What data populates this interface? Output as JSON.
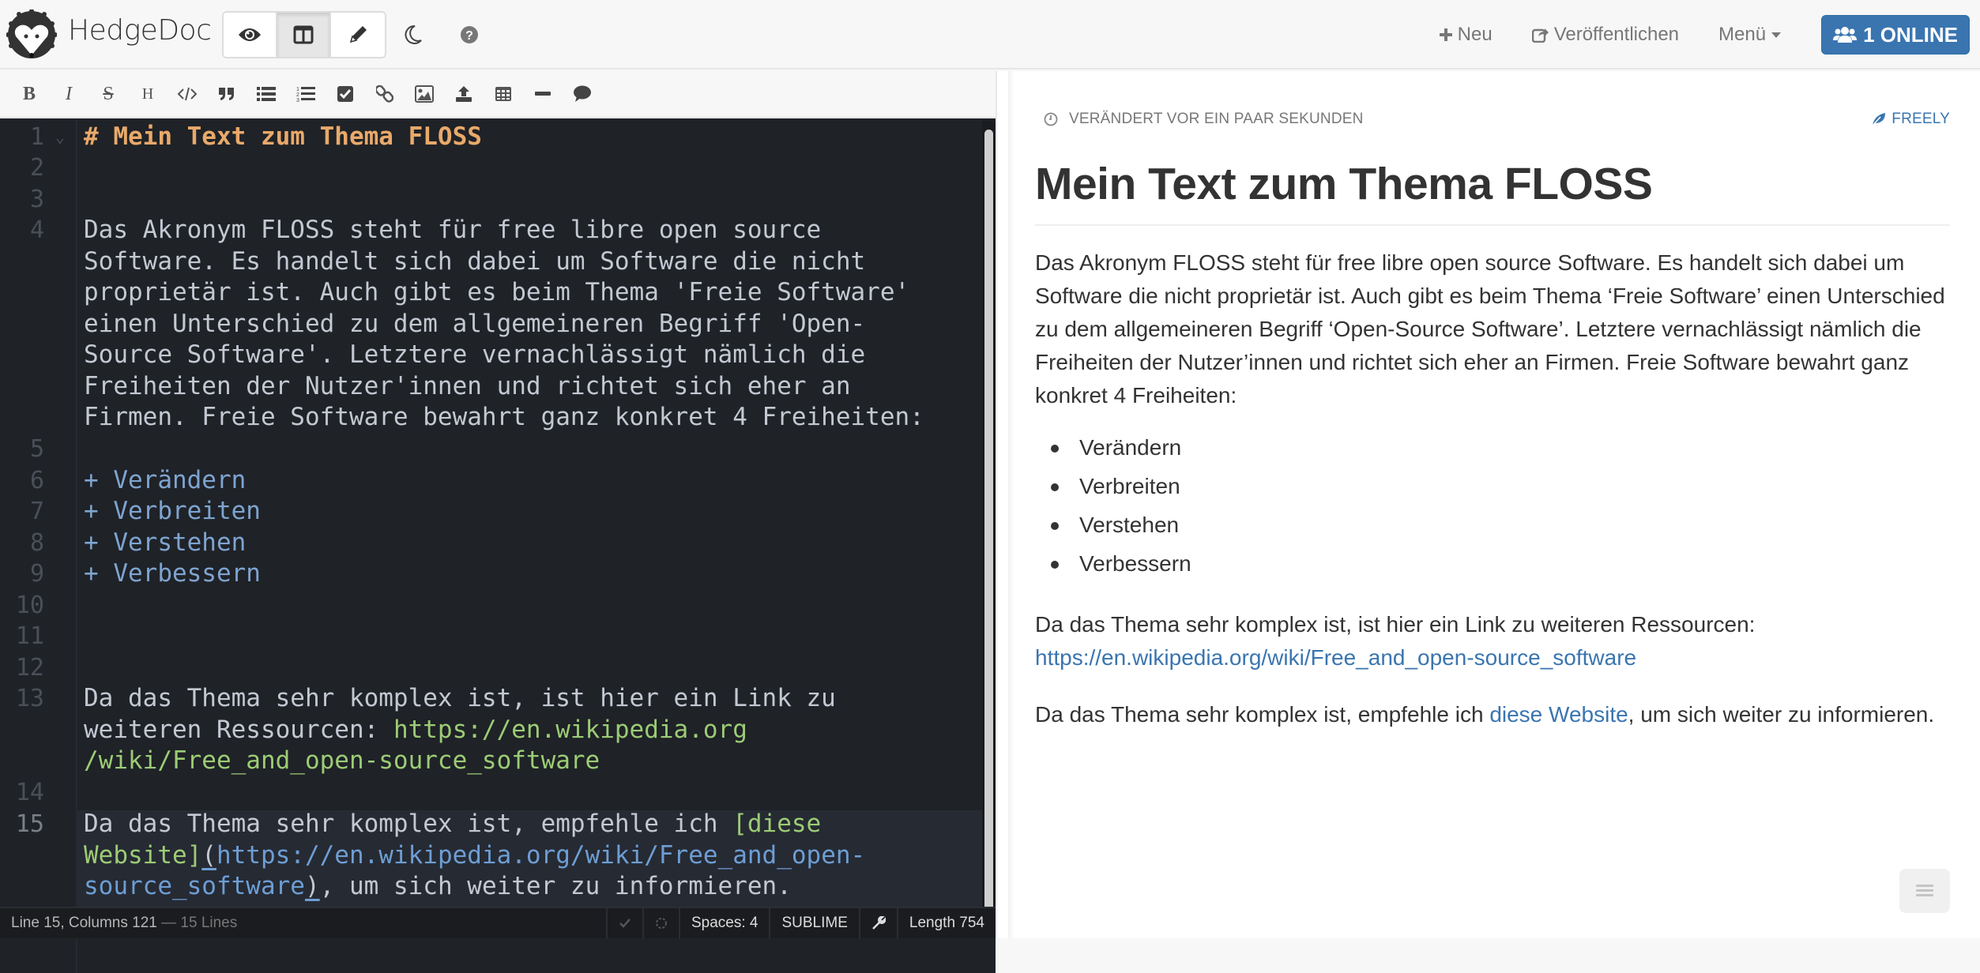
{
  "navbar": {
    "brand": "HedgeDoc",
    "view_modes": [
      {
        "name": "view",
        "icon": "eye-icon",
        "active": false
      },
      {
        "name": "both",
        "icon": "columns-icon",
        "active": true
      },
      {
        "name": "edit",
        "icon": "pencil-icon",
        "active": false
      }
    ],
    "night_mode_icon": "moon-icon",
    "help_icon": "question-circle-icon",
    "new_label": "Neu",
    "publish_label": "Veröffentlichen",
    "menu_label": "Menü",
    "online_label": "1 ONLINE",
    "accent_color": "#3a75b0"
  },
  "toolbar": {
    "buttons": [
      {
        "name": "bold",
        "icon": "bold-icon"
      },
      {
        "name": "italic",
        "icon": "italic-icon"
      },
      {
        "name": "strikethrough",
        "icon": "strikethrough-icon"
      },
      {
        "name": "header",
        "icon": "header-icon"
      },
      {
        "name": "code",
        "icon": "code-icon"
      },
      {
        "name": "quote",
        "icon": "quote-icon"
      },
      {
        "name": "unordered-list",
        "icon": "list-icon"
      },
      {
        "name": "ordered-list",
        "icon": "ordered-list-icon"
      },
      {
        "name": "check-list",
        "icon": "checkbox-icon"
      },
      {
        "name": "link",
        "icon": "link-icon"
      },
      {
        "name": "image",
        "icon": "image-icon"
      },
      {
        "name": "upload",
        "icon": "upload-icon"
      },
      {
        "name": "table",
        "icon": "table-icon"
      },
      {
        "name": "horizontal-line",
        "icon": "minus-icon"
      },
      {
        "name": "comment",
        "icon": "comment-icon"
      }
    ],
    "bold_glyph": "B",
    "italic_glyph": "I",
    "strike_glyph": "S",
    "header_glyph": "H"
  },
  "editor": {
    "lines": [
      {
        "n": "1",
        "text": "# Mein Text zum Thema FLOSS"
      },
      {
        "n": "2",
        "text": ""
      },
      {
        "n": "3",
        "text": ""
      },
      {
        "n": "4",
        "wrapped": [
          "Das Akronym FLOSS steht für free libre open source",
          "Software. Es handelt sich dabei um Software die nicht",
          "proprietär ist. Auch gibt es beim Thema 'Freie Software'",
          "einen Unterschied zu dem allgemeineren Begriff 'Open-",
          "Source Software'. Letztere vernachlässigt nämlich die",
          "Freiheiten der Nutzer'innen und richtet sich eher an",
          "Firmen. Freie Software bewahrt ganz konkret 4 Freiheiten:"
        ]
      },
      {
        "n": "5",
        "text": ""
      },
      {
        "n": "6",
        "text": "+ Verändern"
      },
      {
        "n": "7",
        "text": "+ Verbreiten"
      },
      {
        "n": "8",
        "text": "+ Verstehen"
      },
      {
        "n": "9",
        "text": "+ Verbessern"
      },
      {
        "n": "10",
        "text": ""
      },
      {
        "n": "11",
        "text": ""
      },
      {
        "n": "12",
        "text": ""
      },
      {
        "n": "13",
        "wrapped": [
          "Da das Thema sehr komplex ist, ist hier ein Link zu",
          "weiteren Ressourcen: ",
          "/wiki/Free_and_open-source_software"
        ],
        "url_part1": "https://en.wikipedia.org"
      },
      {
        "n": "14",
        "text": ""
      },
      {
        "n": "15",
        "line1_plain": "Da das Thema sehr komplex ist, empfehle ich ",
        "line1_link": "[diese",
        "line2_link": "Website]",
        "line2_paren": "(",
        "line2_url": "https://en.wikipedia.org/wiki/Free_and_open-",
        "line3_url": "source_software",
        "line3_paren": ")",
        "line3_rest": ", um sich weiter zu informieren."
      }
    ]
  },
  "statusbar": {
    "position": "Line 15, Columns 121",
    "line_count": "— 15 Lines",
    "spaces": "Spaces: 4",
    "keymap": "SUBLIME",
    "length": "Length 754"
  },
  "preview": {
    "changed": "VERÄNDERT VOR EIN PAAR SEKUNDEN",
    "permission": "FREELY",
    "title": "Mein Text zum Thema FLOSS",
    "paragraph1": "Das Akronym FLOSS steht für free libre open source Software. Es handelt sich dabei um Software die nicht proprietär ist. Auch gibt es beim Thema ‘Freie Software’ einen Unterschied zu dem allgemeineren Begriff ‘Open-Source Software’. Letztere vernachlässigt nämlich die Freiheiten der Nutzer’innen und richtet sich eher an Firmen. Freie Software bewahrt ganz konkret 4 Freiheiten:",
    "list": [
      "Verändern",
      "Verbreiten",
      "Verstehen",
      "Verbessern"
    ],
    "paragraph2_text": "Da das Thema sehr komplex ist, ist hier ein Link zu weiteren Ressourcen:",
    "paragraph2_link": "https://en.wikipedia.org/wiki/Free_and_open-source_software",
    "paragraph3_before": "Da das Thema sehr komplex ist, empfehle ich ",
    "paragraph3_link": "diese Website",
    "paragraph3_after": ", um sich weiter zu informieren."
  }
}
